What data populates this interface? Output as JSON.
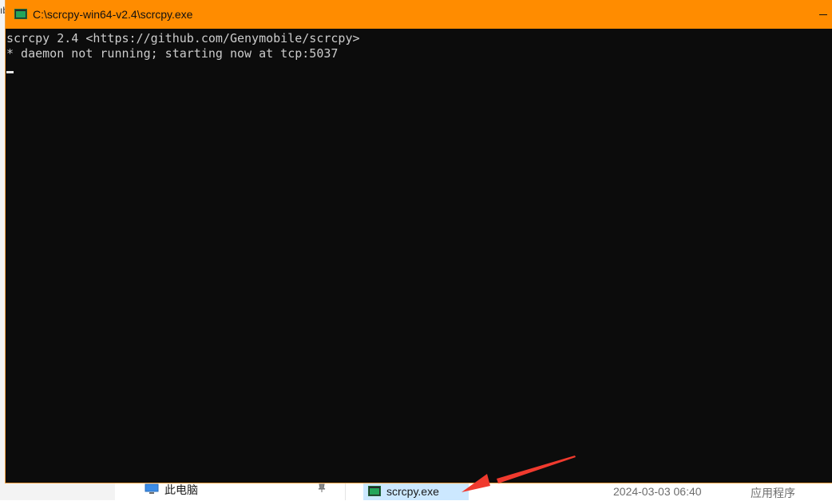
{
  "console": {
    "title": "C:\\scrcpy-win64-v2.4\\scrcpy.exe",
    "lines": [
      "scrcpy 2.4 <https://github.com/Genymobile/scrcpy>",
      "* daemon not running; starting now at tcp:5037"
    ]
  },
  "explorer": {
    "left_edge_glyph": "ıb",
    "nav_item_label": "此电脑",
    "file": {
      "name": "scrcpy.exe",
      "date": "2024-03-03 06:40",
      "type": "应用程序"
    }
  },
  "icons": {
    "title_icon": "console-app-icon",
    "nav_icon": "computer-icon",
    "pin_icon": "pin-icon",
    "file_icon": "console-app-icon"
  },
  "colors": {
    "titlebar": "#ff8c00",
    "console_bg": "#0c0c0c",
    "console_text": "#cccccc",
    "arrow": "#f03a2e",
    "selection": "#cce8ff"
  }
}
